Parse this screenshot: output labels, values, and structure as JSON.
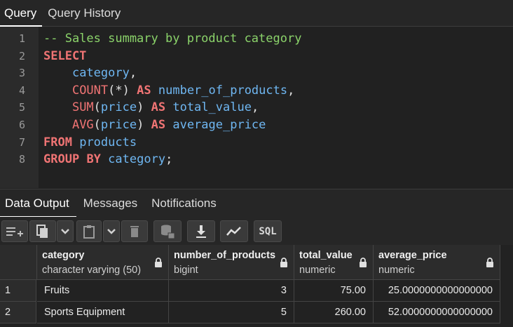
{
  "top_tabs": [
    {
      "label": "Query",
      "active": true
    },
    {
      "label": "Query History",
      "active": false
    }
  ],
  "editor": {
    "line_numbers": [
      "1",
      "2",
      "3",
      "4",
      "5",
      "6",
      "7",
      "8"
    ],
    "lines": [
      "-- Sales summary by product category",
      "SELECT",
      "    category,",
      "    COUNT(*) AS number_of_products,",
      "    SUM(price) AS total_value,",
      "    AVG(price) AS average_price",
      "FROM products",
      "GROUP BY category;"
    ]
  },
  "bottom_tabs": [
    {
      "label": "Data Output",
      "active": true
    },
    {
      "label": "Messages",
      "active": false
    },
    {
      "label": "Notifications",
      "active": false
    }
  ],
  "toolbar": {
    "sql_label": "SQL",
    "icons": [
      "add-row-icon",
      "copy-icon",
      "chevron-down-icon",
      "paste-icon",
      "chevron-down-icon",
      "delete-icon",
      "save-data-icon",
      "download-icon",
      "graph-icon",
      "sql-icon"
    ]
  },
  "grid": {
    "columns": [
      {
        "name": "category",
        "type": "character varying (50)"
      },
      {
        "name": "number_of_products",
        "type": "bigint"
      },
      {
        "name": "total_value",
        "type": "numeric"
      },
      {
        "name": "average_price",
        "type": "numeric"
      }
    ],
    "rows": [
      {
        "num": "1",
        "cells": [
          "Fruits",
          "3",
          "75.00",
          "25.0000000000000000"
        ]
      },
      {
        "num": "2",
        "cells": [
          "Sports Equipment",
          "5",
          "260.00",
          "52.0000000000000000"
        ]
      }
    ]
  },
  "colors": {
    "keyword": "#f07474",
    "identifier": "#6fb7f2",
    "comment": "#8bd36a",
    "background": "#222222"
  }
}
